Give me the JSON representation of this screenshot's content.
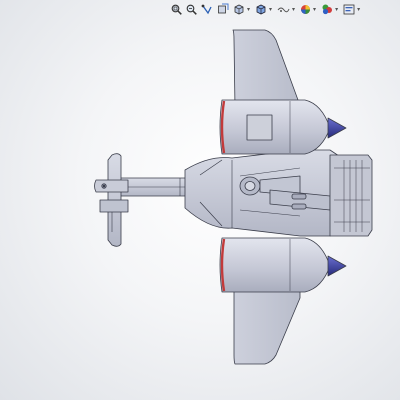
{
  "heads_up_toolbar": {
    "buttons": [
      {
        "name": "zoom-to-fit-icon"
      },
      {
        "name": "zoom-to-area-icon"
      },
      {
        "name": "previous-view-icon"
      },
      {
        "name": "section-view-icon"
      },
      {
        "name": "view-orientation-icon",
        "has_dropdown": true
      },
      {
        "name": "display-style-icon",
        "has_dropdown": true
      },
      {
        "name": "hide-show-items-icon",
        "has_dropdown": true
      },
      {
        "name": "edit-appearance-icon",
        "has_dropdown": true
      },
      {
        "name": "apply-scene-icon",
        "has_dropdown": true
      },
      {
        "name": "view-settings-icon",
        "has_dropdown": true
      }
    ],
    "dropdown_glyph": "▾"
  },
  "model": {
    "name": "aircraft-assembly",
    "view": "top",
    "colors": {
      "body": "#c9ccd8",
      "body_shade": "#aeb2c2",
      "edge": "#3a3d4a",
      "nacelle_ring": "#c23a3a",
      "spinner": "#3b3f9e",
      "background_center": "#ffffff",
      "background_edge": "#dfe2e7"
    }
  }
}
